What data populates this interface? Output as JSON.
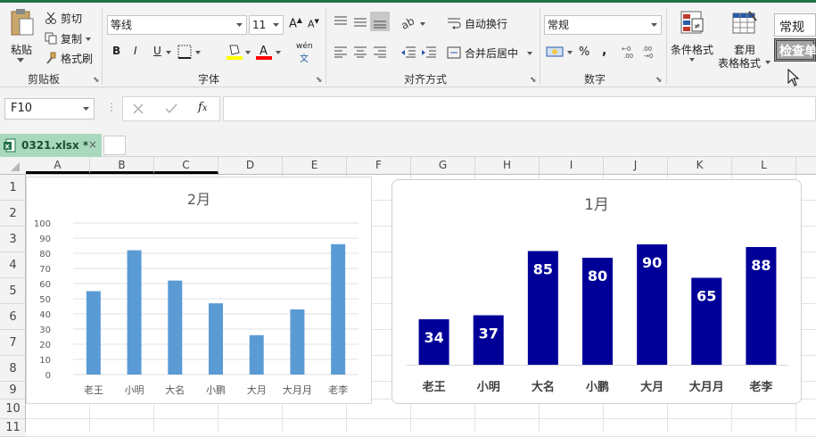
{
  "ribbon": {
    "clipboard": {
      "paste": "粘贴",
      "cut": "剪切",
      "copy": "复制",
      "format_painter": "格式刷",
      "label": "剪贴板"
    },
    "font": {
      "name": "等线",
      "size": "11",
      "label": "字体",
      "bold": "B",
      "italic": "I",
      "underline": "U",
      "phonetic": "wén"
    },
    "alignment": {
      "wrap": "自动换行",
      "merge": "合并后居中",
      "label": "对齐方式"
    },
    "number": {
      "format": "常规",
      "percent": "%",
      "comma": ",",
      "label": "数字"
    },
    "styles": {
      "conditional": "条件格式",
      "table_line1": "套用",
      "table_line2": "表格格式",
      "style_normal": "常规",
      "style_check": "检查单"
    }
  },
  "formula_bar": {
    "name_box": "F10",
    "fx": "fx",
    "formula": ""
  },
  "tab": {
    "name": "0321.xlsx *",
    "close": "×"
  },
  "columns": [
    "A",
    "B",
    "C",
    "D",
    "E",
    "F",
    "G",
    "H",
    "I",
    "J",
    "K",
    "L"
  ],
  "rows": [
    "1",
    "2",
    "3",
    "4",
    "5",
    "6",
    "7",
    "8",
    "9",
    "10",
    "11"
  ],
  "colors": {
    "excel_green": "#217346",
    "bar_blue": "#5b9bd5",
    "bar_navy": "#000099"
  },
  "chart_data": [
    {
      "type": "bar",
      "title": "2月",
      "categories": [
        "老王",
        "小明",
        "大名",
        "小鹏",
        "大月",
        "大月月",
        "老李"
      ],
      "values": [
        55,
        82,
        62,
        47,
        26,
        43,
        86
      ],
      "yticks": [
        "0",
        "10",
        "20",
        "30",
        "40",
        "50",
        "60",
        "70",
        "80",
        "90",
        "100"
      ],
      "ylim": [
        0,
        100
      ],
      "grid": true
    },
    {
      "type": "bar",
      "title": "1月",
      "categories": [
        "老王",
        "小明",
        "大名",
        "小鹏",
        "大月",
        "大月月",
        "老李"
      ],
      "values": [
        34,
        37,
        85,
        80,
        90,
        65,
        88
      ],
      "data_labels": [
        "34",
        "37",
        "85",
        "80",
        "90",
        "65",
        "88"
      ],
      "ylim": [
        0,
        100
      ],
      "grid": false
    }
  ]
}
